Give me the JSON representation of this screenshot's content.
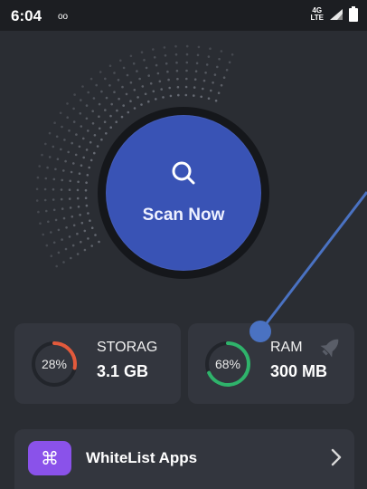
{
  "status_bar": {
    "time": "6:04",
    "voicemail_icon": "oo",
    "network_label": "4G",
    "network_sub": "LTE",
    "signal_icon": "signal-icon",
    "battery_icon": "battery-icon"
  },
  "scan": {
    "label": "Scan Now",
    "icon": "search-icon",
    "button_color": "#3953b5"
  },
  "storage": {
    "title": "STORAG",
    "value": "3.1 GB",
    "percent_label": "28%",
    "percent": 28,
    "accent": "#e25a3c"
  },
  "ram": {
    "title": "RAM",
    "value": "300 MB",
    "percent_label": "68%",
    "percent": 68,
    "accent": "#2fb36b",
    "icon": "rocket-icon"
  },
  "whitelist": {
    "label": "WhiteList Apps",
    "icon": "command-icon",
    "icon_glyph": "⌘",
    "accent": "#8a52ea"
  },
  "colors": {
    "background": "#2a2d33",
    "card": "#33363e",
    "overlay_line": "#4a72c2"
  }
}
